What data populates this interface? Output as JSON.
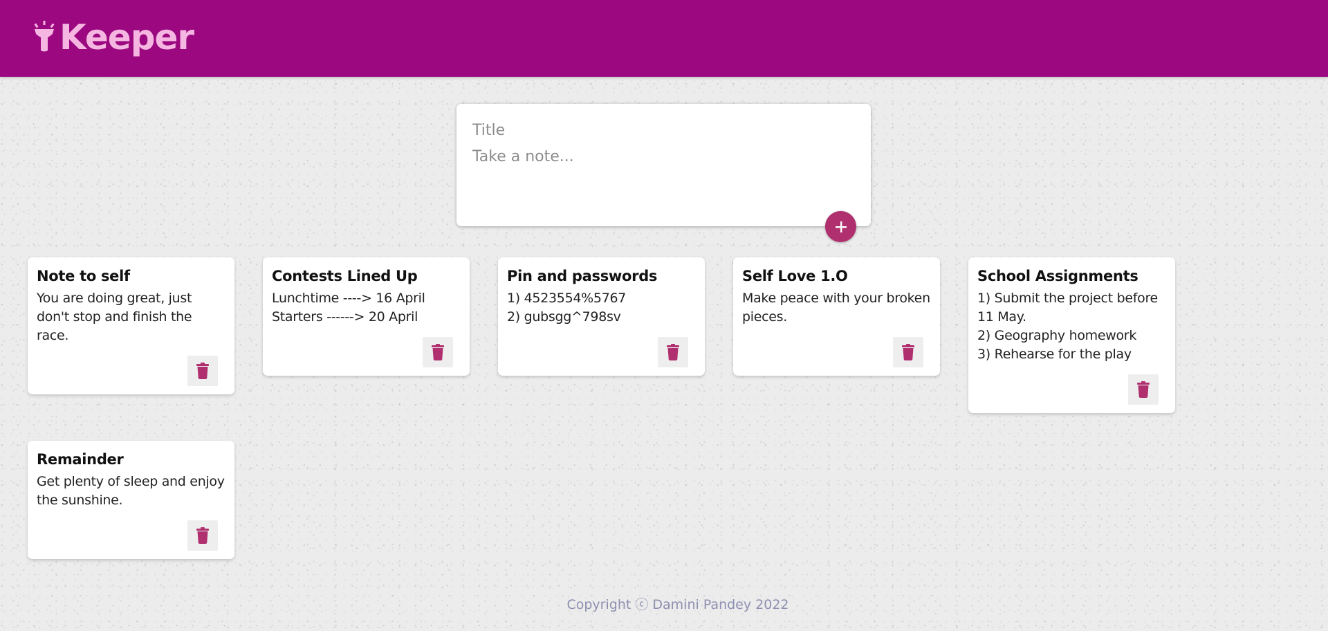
{
  "header": {
    "brand_title": "Keeper",
    "brand_color": "#9b0880",
    "brand_text_color": "#f5b7e1",
    "brand_icon": "torch-icon"
  },
  "compose": {
    "title_placeholder": "Title",
    "content_placeholder": "Take a note...",
    "add_icon": "plus-icon",
    "accent_color": "#b0306f"
  },
  "notes": [
    {
      "title": "Note to self",
      "content": "You are doing great, just don't stop and finish the race.",
      "delete_icon": "trash-icon"
    },
    {
      "title": "Contests Lined Up",
      "content": "Lunchtime ----> 16 April\nStarters ------> 20 April",
      "delete_icon": "trash-icon"
    },
    {
      "title": "Pin and passwords",
      "content": "1) 4523554%5767\n2) gubsgg^798sv",
      "delete_icon": "trash-icon"
    },
    {
      "title": "Self Love 1.O",
      "content": "Make peace with your broken pieces.",
      "delete_icon": "trash-icon"
    },
    {
      "title": "School Assignments",
      "content": "1) Submit the project before 11 May.\n2) Geography homework\n3) Rehearse for the play",
      "delete_icon": "trash-icon"
    },
    {
      "title": "Remainder",
      "content": "Get plenty of sleep and enjoy the sunshine.",
      "delete_icon": "trash-icon"
    }
  ],
  "footer": {
    "text": "Copyright ⓒ Damini Pandey 2022"
  }
}
